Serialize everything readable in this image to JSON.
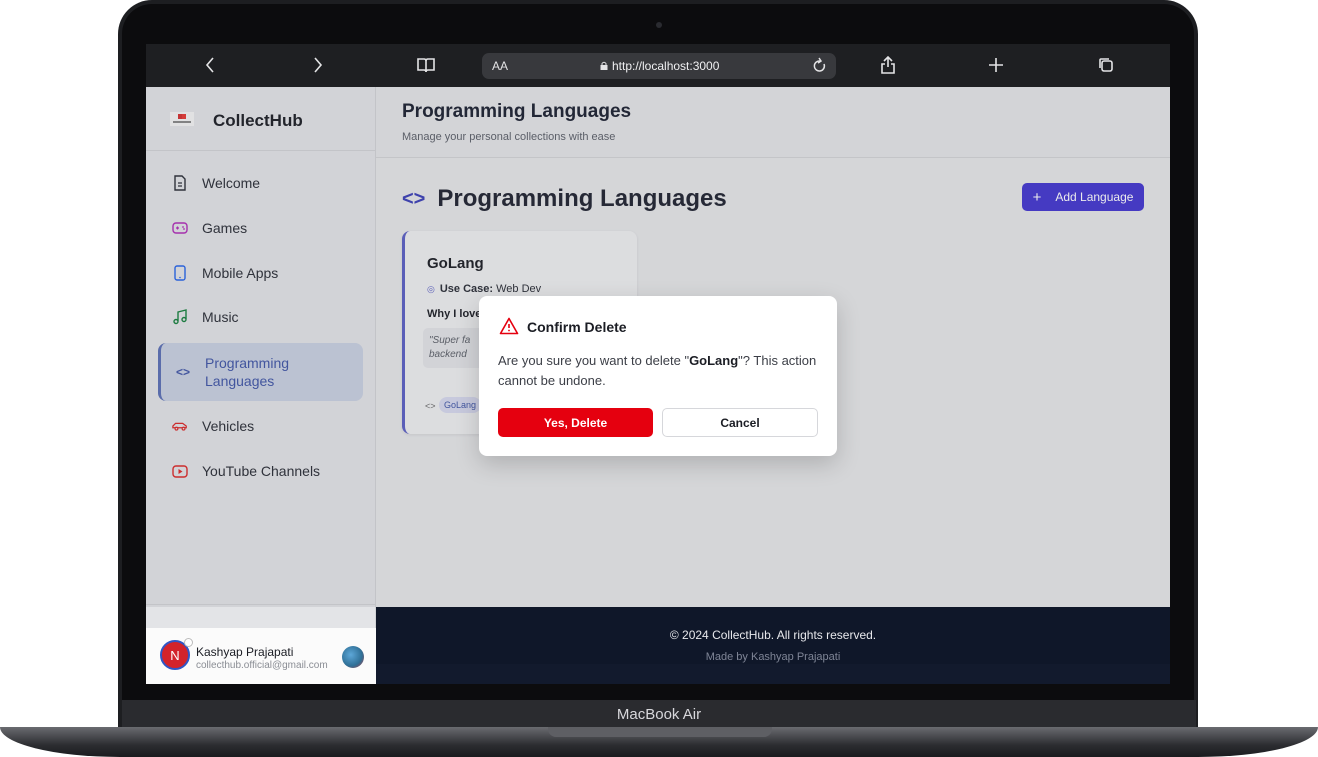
{
  "device": {
    "label": "MacBook Air"
  },
  "browser": {
    "reader_label": "AA",
    "url": "http://localhost:3000"
  },
  "sidebar": {
    "app_name": "CollectHub",
    "items": [
      {
        "label": "Welcome",
        "icon": "document-icon"
      },
      {
        "label": "Games",
        "icon": "gamepad-icon"
      },
      {
        "label": "Mobile Apps",
        "icon": "smartphone-icon"
      },
      {
        "label": "Music",
        "icon": "music-icon"
      },
      {
        "label": "Programming Languages",
        "icon": "code-icon",
        "active": true
      },
      {
        "label": "Vehicles",
        "icon": "car-icon"
      },
      {
        "label": "YouTube Channels",
        "icon": "youtube-icon"
      }
    ],
    "user": {
      "initial": "N",
      "name": "Kashyap Prajapati",
      "email": "collecthub.official@gmail.com"
    }
  },
  "header": {
    "title": "Programming Languages",
    "subtitle": "Manage your personal collections with ease"
  },
  "main": {
    "section_icon": "<>",
    "section_title": "Programming Languages",
    "add_button": "Add Language",
    "card": {
      "title": "GoLang",
      "use_case_label": "Use Case:",
      "use_case_value": "Web Dev",
      "why_label": "Why I love",
      "quote_line1": "\"Super fa",
      "quote_line2": "backend",
      "tag": "GoLang"
    }
  },
  "modal": {
    "title": "Confirm Delete",
    "message_before": "Are you sure you want to delete \"",
    "message_name": "GoLang",
    "message_after": "\"? This action cannot be undone.",
    "confirm_label": "Yes, Delete",
    "cancel_label": "Cancel"
  },
  "footer": {
    "copyright": "© 2024 CollectHub. All rights reserved.",
    "made_by": "Made by Kashyap Prajapati"
  },
  "colors": {
    "accent": "#4336d0",
    "danger": "#e5000f",
    "footer_bg": "#0f1729"
  }
}
